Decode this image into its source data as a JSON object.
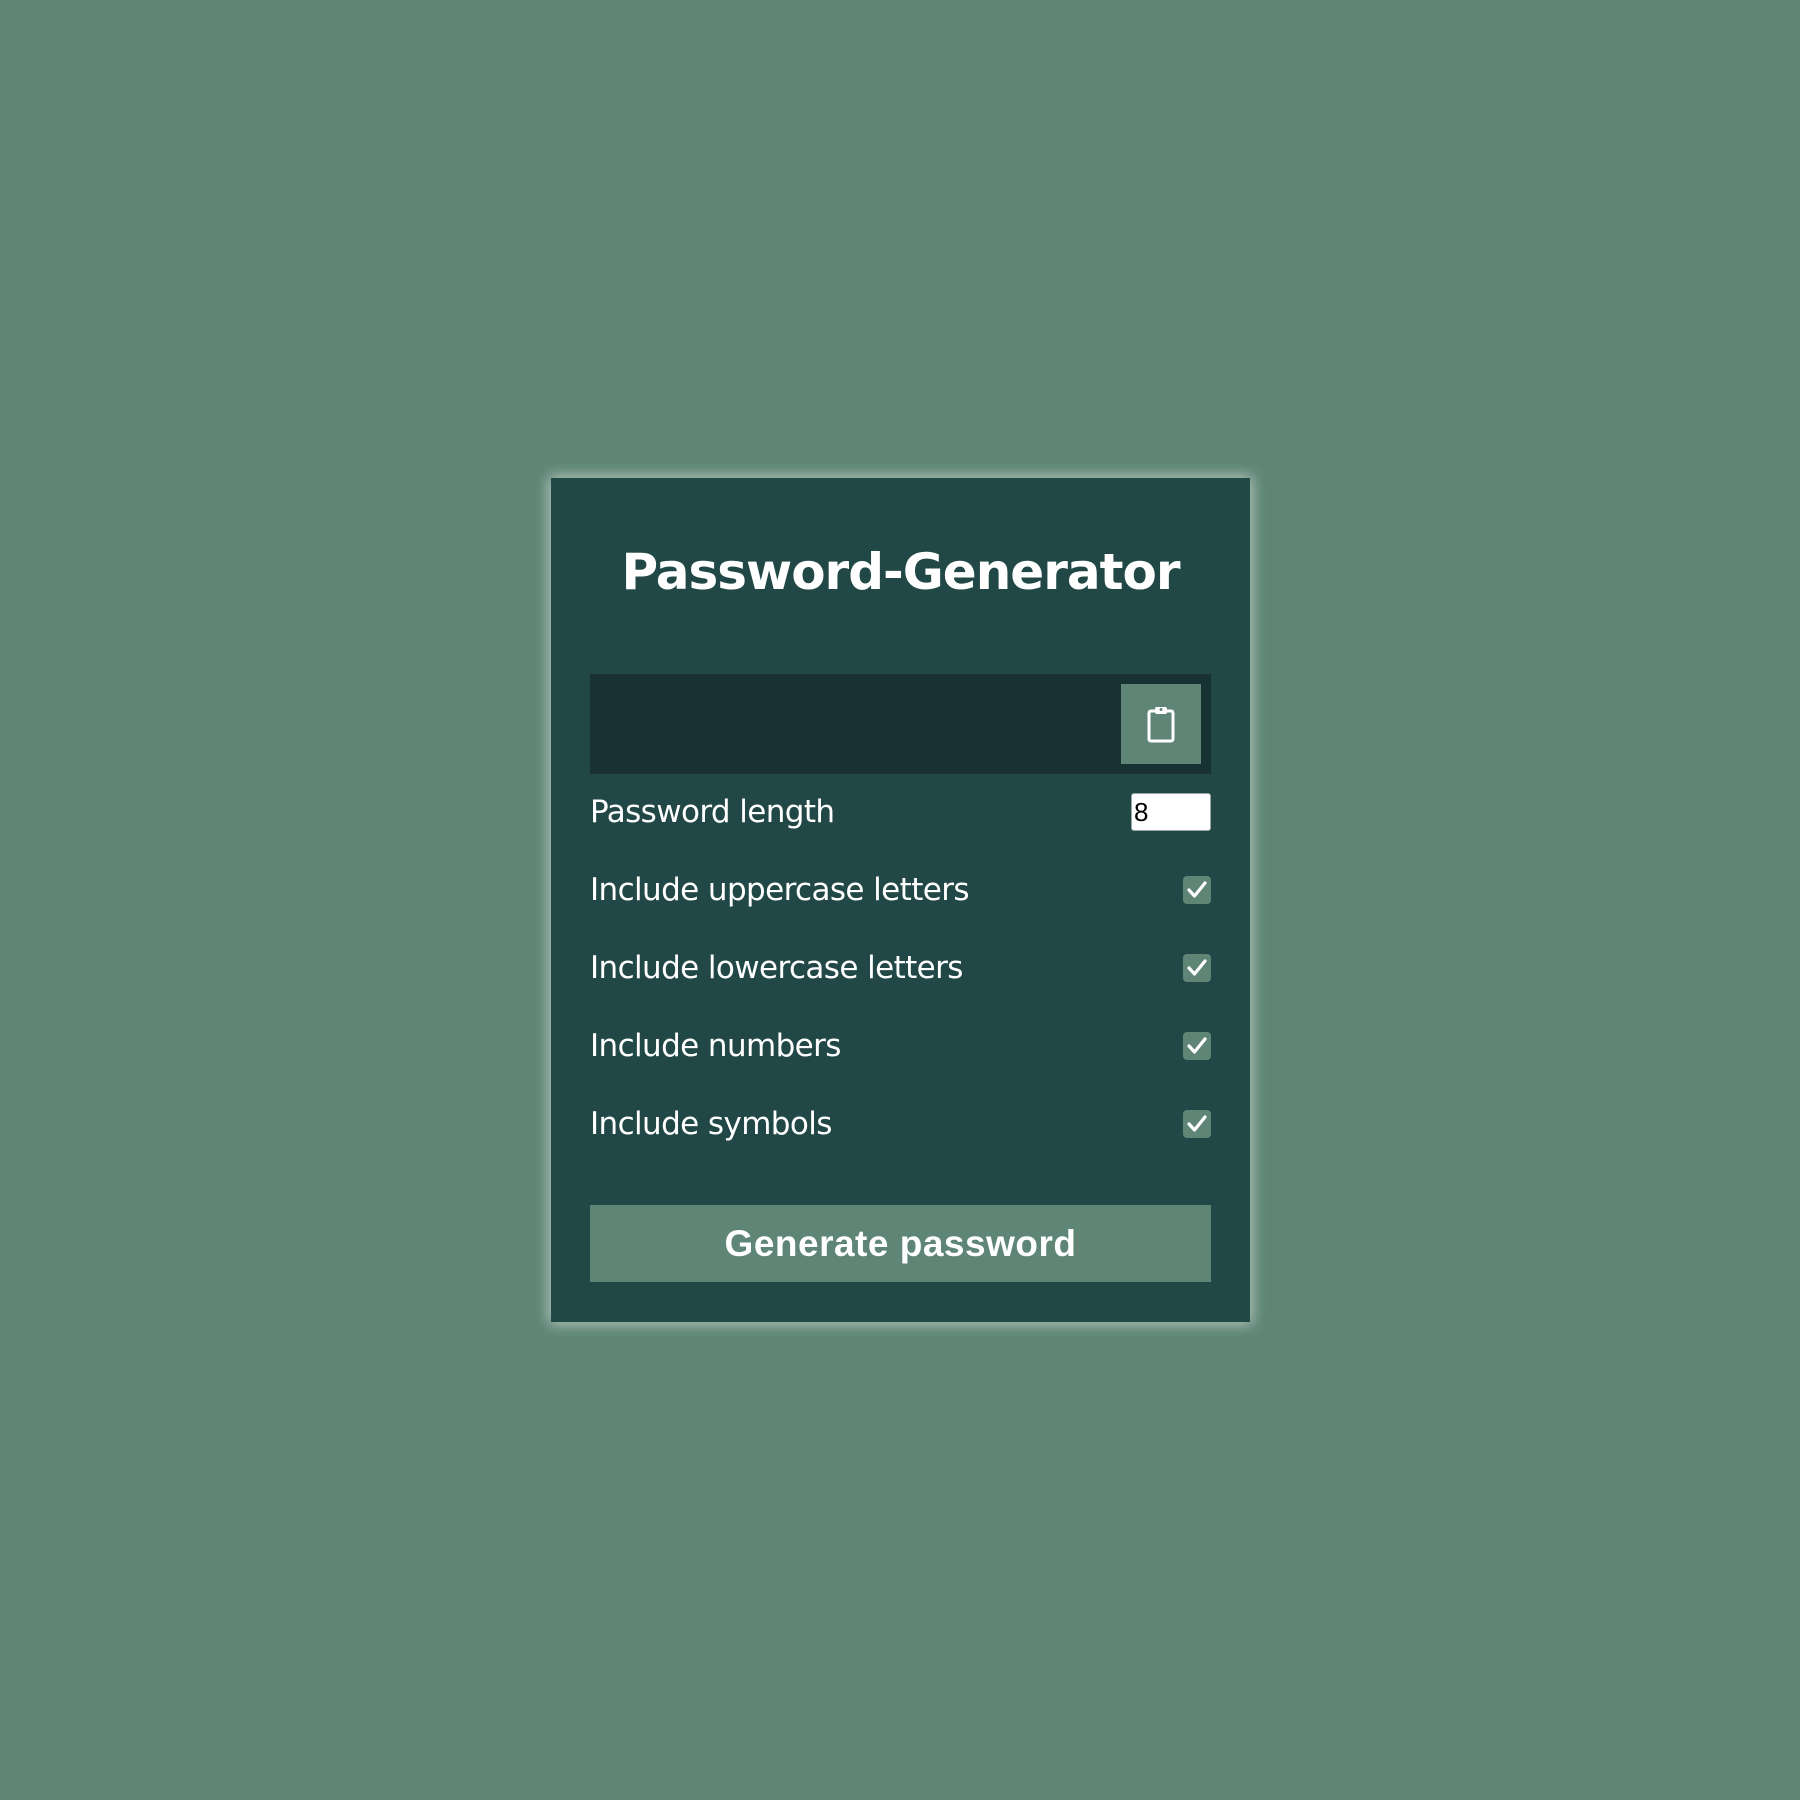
{
  "app": {
    "title": "Password-Generator"
  },
  "result": {
    "value": "",
    "copy_icon": "clipboard-icon"
  },
  "settings": {
    "length": {
      "label": "Password length",
      "value": "8"
    },
    "uppercase": {
      "label": "Include uppercase letters",
      "checked": true
    },
    "lowercase": {
      "label": "Include lowercase letters",
      "checked": true
    },
    "numbers": {
      "label": "Include numbers",
      "checked": true
    },
    "symbols": {
      "label": "Include symbols",
      "checked": true
    }
  },
  "generate_button": {
    "label": "Generate password"
  },
  "colors": {
    "background": "#5e8575",
    "card": "#214846",
    "result_bg": "#183133",
    "accent": "#5e8575",
    "text": "#ffffff"
  }
}
